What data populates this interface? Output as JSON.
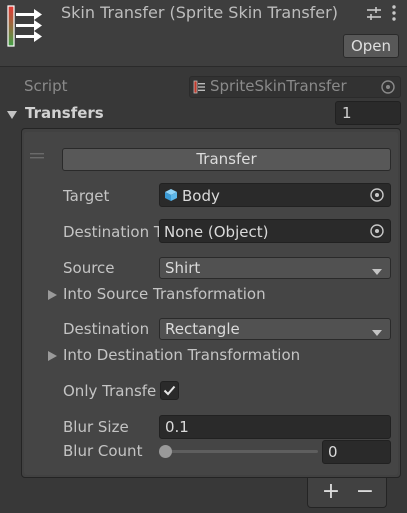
{
  "header": {
    "title": "Skin Transfer (Sprite Skin Transfer)",
    "open_label": "Open",
    "component_icon": "component-arrows-icon",
    "settings_icon": "presets-sliders-icon",
    "menu_icon": "kebab-menu-icon"
  },
  "script": {
    "label": "Script",
    "value": "SpriteSkinTransfer",
    "icon": "csharp-script-icon"
  },
  "transfers": {
    "label": "Transfers",
    "count": "1"
  },
  "element": {
    "transfer_button": "Transfer",
    "target_label": "Target",
    "target_value": "Body",
    "destination_target_label": "Destination T",
    "destination_target_value": "None (Object)",
    "source_label": "Source",
    "source_value": "Shirt",
    "into_source_label": "Into Source Transformation",
    "destination_label": "Destination",
    "destination_value": "Rectangle",
    "into_destination_label": "Into Destination Transformation",
    "only_transfer_label": "Only Transfe",
    "only_transfer_checked": true,
    "blur_size_label": "Blur Size",
    "blur_size_value": "0.1",
    "blur_count_label": "Blur Count",
    "blur_count_value": "0"
  },
  "list_footer": {
    "add_label": "+",
    "remove_label": "−"
  },
  "colors": {
    "background": "#383838",
    "field": "#2a2a2a",
    "button": "#585858",
    "text": "#c4c4c4",
    "icon_red": "#e53935",
    "icon_green": "#4caf50"
  }
}
